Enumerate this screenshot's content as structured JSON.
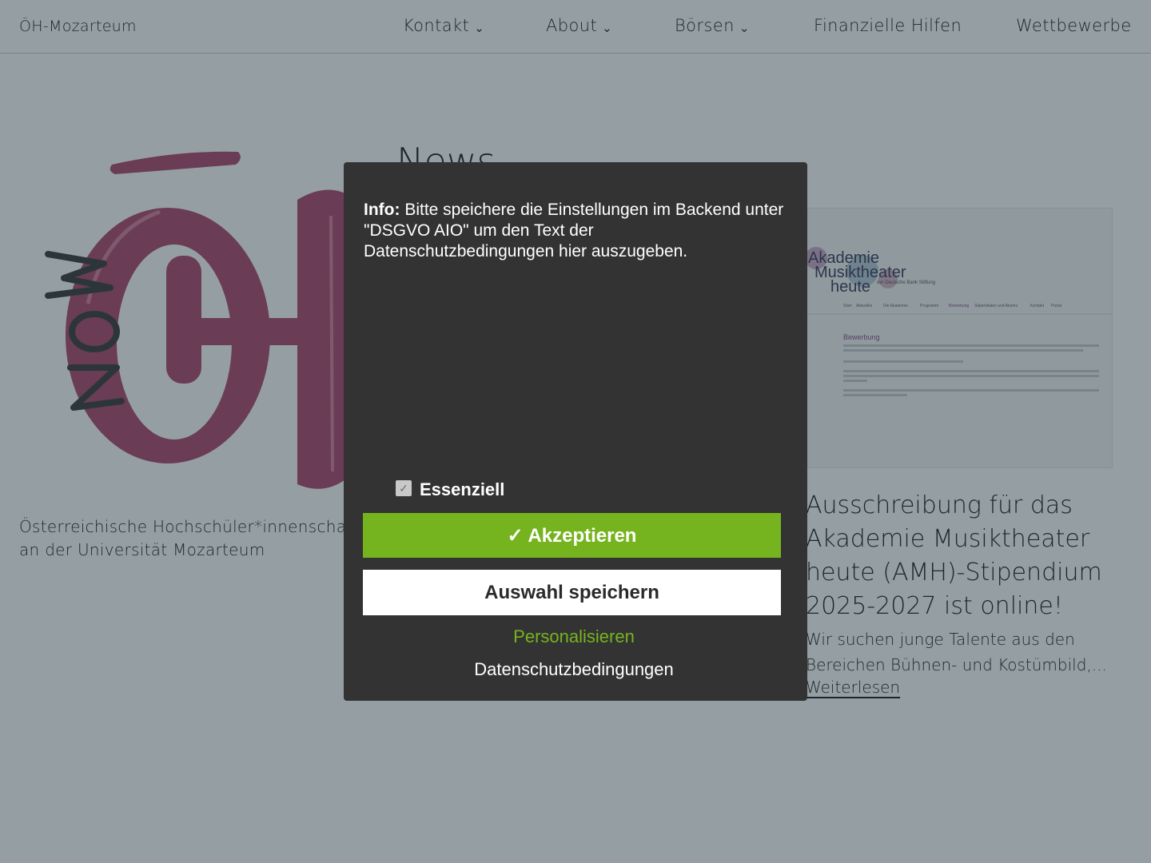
{
  "header": {
    "site_title": "ÖH-Mozarteum",
    "nav": [
      {
        "label": "Kontakt",
        "has_submenu": true
      },
      {
        "label": "About",
        "has_submenu": true
      },
      {
        "label": "Börsen",
        "has_submenu": true
      },
      {
        "label": "Finanzielle Hilfen",
        "has_submenu": false
      },
      {
        "label": "Wettbewerbe",
        "has_submenu": false
      }
    ],
    "chevron_glyph": "⌄"
  },
  "logo": {
    "letters_main": "ÖH",
    "letters_side": "moz",
    "colors": {
      "primary": "#b0456f",
      "dark": "#3a3a3a"
    }
  },
  "tagline": "Österreichische Hochschüler*innenschaft an der Universität Mozarteum",
  "news": {
    "heading": "News",
    "card": {
      "image_text": {
        "logo_line1": "Akademie",
        "logo_line2": "Musiktheater",
        "logo_line3": "heute",
        "logo_sub": "der Deutsche Bank Stiftung",
        "menu": [
          "Start",
          "Aktuelles",
          "Die Akademie",
          "Programm",
          "Bewerbung",
          "Stipendiaten und Alumni",
          "Kontakt",
          "Portal"
        ],
        "section_title": "Bewerbung"
      },
      "title": "Ausschreibung für das Akademie Musiktheater heute (AMH)-Stipendium 2025-2027 ist online!",
      "excerpt": "Wir suchen junge Talente aus den Bereichen Bühnen- und Kostümbild,...",
      "read_more": "Weiterlesen"
    }
  },
  "modal": {
    "info_label": "Info:",
    "info_text": " Bitte speichere die Einstellungen im Backend unter \"DSGVO AIO\" um den Text der Datenschutzbedingungen hier auszugeben.",
    "checkbox_label": "Essenziell",
    "checkbox_checked": true,
    "accept_label": "✓ Akzeptieren",
    "save_label": "Auswahl speichern",
    "personalize_label": "Personalisieren",
    "privacy_label": "Datenschutzbedingungen",
    "colors": {
      "bg": "#333333",
      "accent": "#76b41f"
    }
  }
}
